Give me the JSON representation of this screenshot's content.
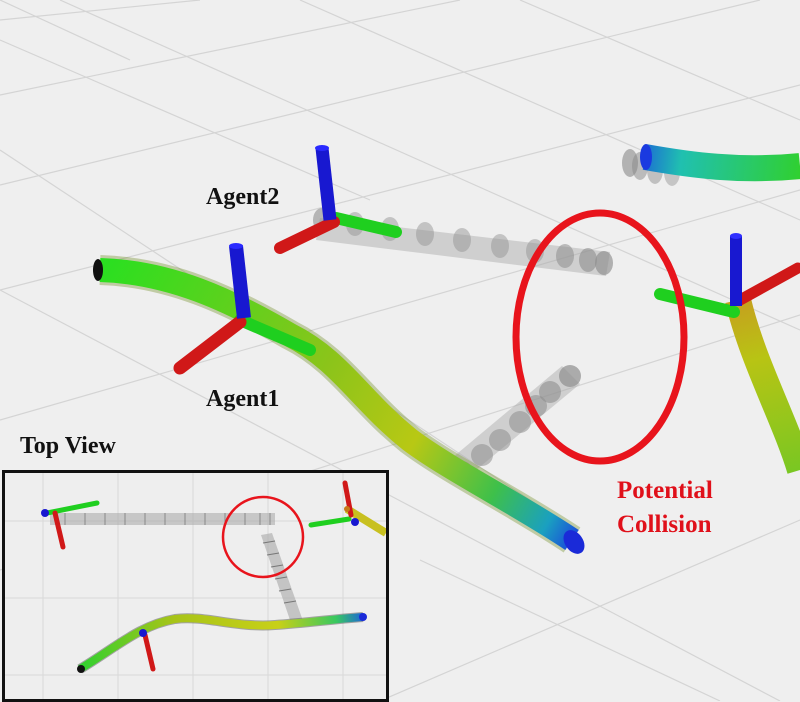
{
  "labels": {
    "agent2": "Agent2",
    "agent1": "Agent1",
    "top_view": "Top View",
    "collision_line1": "Potential",
    "collision_line2": "Collision"
  },
  "colors": {
    "axis_x": "#d01818",
    "axis_y": "#1fcf1f",
    "axis_z": "#1818d0",
    "collision": "#e8141c",
    "ghost": "#9a9a9a",
    "grid": "#d6d6d6",
    "background": "#efefef"
  }
}
